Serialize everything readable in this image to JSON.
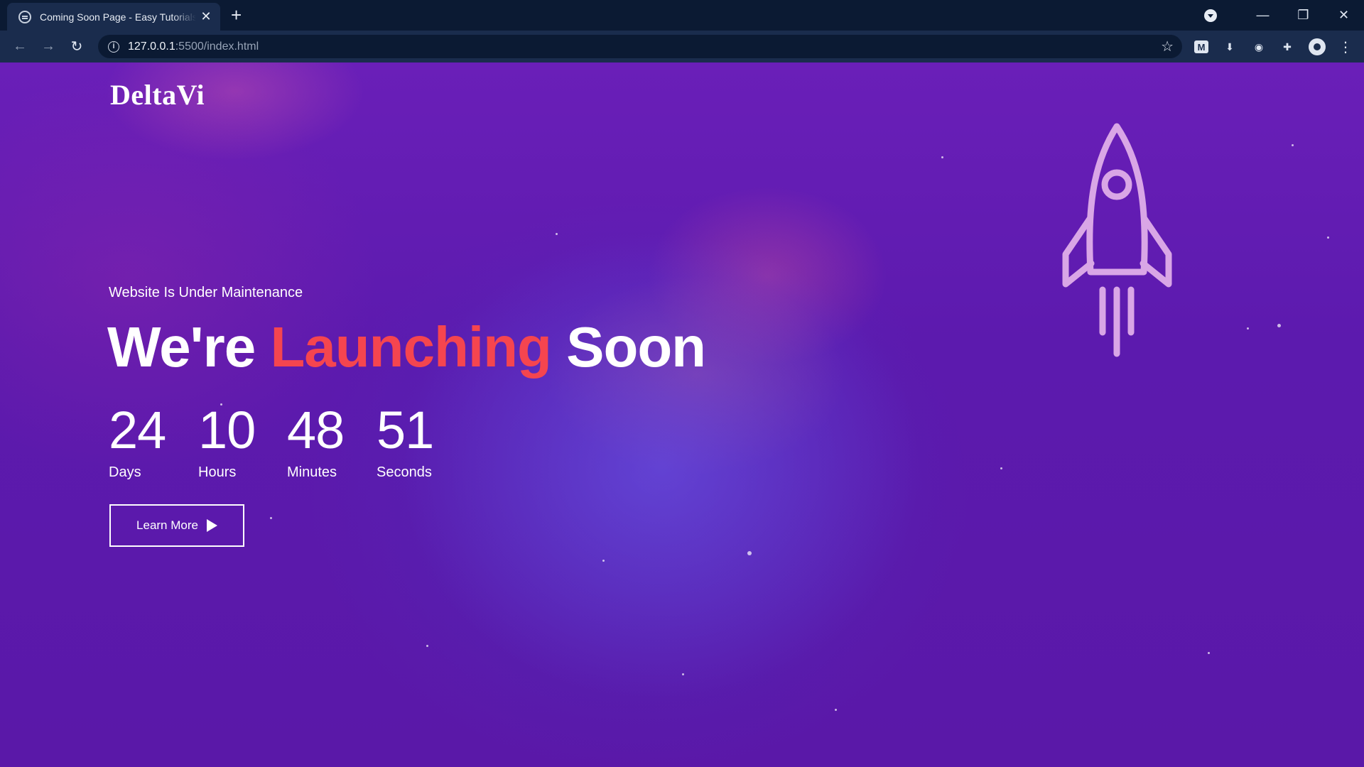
{
  "browser": {
    "tab_title": "Coming Soon Page - Easy Tutorials",
    "tab_close": "✕",
    "new_tab": "+",
    "url_host": "127.0.0.1",
    "url_path": ":5500/index.html",
    "controls": {
      "minimize": "—",
      "restore": "❐",
      "close": "✕"
    },
    "ext_m_label": "M"
  },
  "page": {
    "logo": "DeltaVi",
    "subtitle": "Website Is Under Maintenance",
    "headline": {
      "part1": "We're ",
      "accent": "Launching",
      "part2": " Soon"
    },
    "countdown": [
      {
        "value": "24",
        "label": "Days"
      },
      {
        "value": "10",
        "label": "Hours"
      },
      {
        "value": "48",
        "label": "Minutes"
      },
      {
        "value": "51",
        "label": "Seconds"
      }
    ],
    "cta_label": "Learn More"
  },
  "colors": {
    "accent": "#f5454f",
    "background": "#5c1aae",
    "rocket": "#d9a6e6"
  },
  "icons": [
    "globe-icon",
    "close-icon",
    "plus-icon",
    "back-arrow-icon",
    "forward-arrow-icon",
    "reload-icon",
    "info-icon",
    "star-icon",
    "extension-icon",
    "download-icon",
    "camera-icon",
    "puzzle-icon",
    "avatar-icon",
    "menu-icon",
    "play-icon",
    "rocket-icon"
  ]
}
